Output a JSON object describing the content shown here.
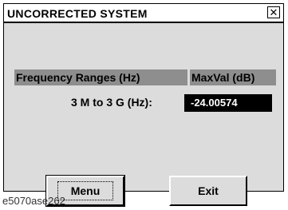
{
  "window": {
    "title": "UNCORRECTED SYSTEM",
    "close_glyph": "✕",
    "close_icon": "close-icon"
  },
  "table": {
    "frequency_header": "Frequency Ranges (Hz)",
    "maxval_header": "MaxVal (dB)",
    "rows": [
      {
        "range": "3 M to 3 G (Hz):",
        "value": "-24.00574"
      }
    ]
  },
  "buttons": {
    "menu_label": "Menu",
    "exit_label": "Exit"
  },
  "caption": "e5070ase262",
  "colors": {
    "dialog_background": "#dcdcdc",
    "header_background": "#8e8e8e",
    "value_background": "#000000",
    "value_text": "#ffffff"
  }
}
